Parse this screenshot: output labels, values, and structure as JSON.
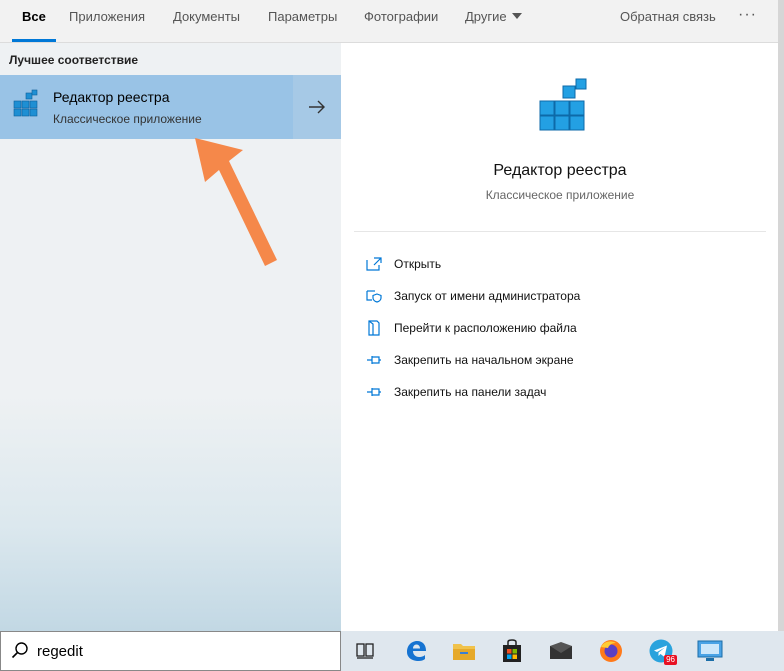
{
  "filters": {
    "tabs": [
      {
        "label": "Все"
      },
      {
        "label": "Приложения"
      },
      {
        "label": "Документы"
      },
      {
        "label": "Параметры"
      },
      {
        "label": "Фотографии"
      },
      {
        "label": "Другие"
      }
    ],
    "feedback": "Обратная связь",
    "more": "···"
  },
  "results": {
    "section_title": "Лучшее соответствие",
    "best_match": {
      "title": "Редактор реестра",
      "subtitle": "Классическое приложение"
    }
  },
  "preview": {
    "title": "Редактор реестра",
    "subtitle": "Классическое приложение",
    "actions": [
      {
        "label": "Открыть",
        "icon": "open-icon"
      },
      {
        "label": "Запуск от имени администратора",
        "icon": "shield-icon"
      },
      {
        "label": "Перейти к расположению файла",
        "icon": "file-location-icon"
      },
      {
        "label": "Закрепить на начальном экране",
        "icon": "pin-icon"
      },
      {
        "label": "Закрепить на панели задач",
        "icon": "pin-icon"
      }
    ]
  },
  "search": {
    "value": "regedit"
  },
  "taskbar": {
    "items": [
      "task-view-icon",
      "edge-icon",
      "file-explorer-icon",
      "store-icon",
      "mail-icon",
      "firefox-icon",
      "telegram-icon",
      "remote-desktop-icon"
    ],
    "telegram_badge": "96"
  },
  "colors": {
    "accent": "#0078d7",
    "selected": "#99c3e6",
    "pointer": "#f5884a"
  }
}
